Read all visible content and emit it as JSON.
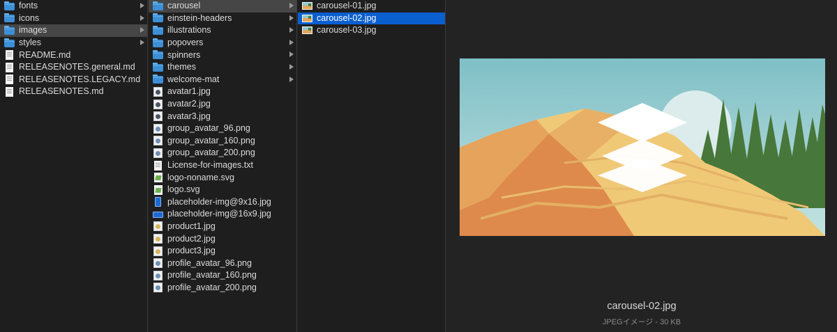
{
  "column1": {
    "items": [
      {
        "label": "fonts",
        "type": "folder"
      },
      {
        "label": "icons",
        "type": "folder"
      },
      {
        "label": "images",
        "type": "folder",
        "selected": true
      },
      {
        "label": "styles",
        "type": "folder"
      },
      {
        "label": "README.md",
        "type": "doc"
      },
      {
        "label": "RELEASENOTES.general.md",
        "type": "doc"
      },
      {
        "label": "RELEASENOTES.LEGACY.md",
        "type": "doc"
      },
      {
        "label": "RELEASENOTES.md",
        "type": "doc"
      }
    ]
  },
  "column2": {
    "items": [
      {
        "label": "carousel",
        "type": "folder",
        "selected": true
      },
      {
        "label": "einstein-headers",
        "type": "folder"
      },
      {
        "label": "illustrations",
        "type": "folder"
      },
      {
        "label": "popovers",
        "type": "folder"
      },
      {
        "label": "spinners",
        "type": "folder"
      },
      {
        "label": "themes",
        "type": "folder"
      },
      {
        "label": "welcome-mat",
        "type": "folder"
      },
      {
        "label": "avatar1.jpg",
        "type": "avatar"
      },
      {
        "label": "avatar2.jpg",
        "type": "avatar"
      },
      {
        "label": "avatar3.jpg",
        "type": "avatar"
      },
      {
        "label": "group_avatar_96.png",
        "type": "image"
      },
      {
        "label": "group_avatar_160.png",
        "type": "image"
      },
      {
        "label": "group_avatar_200.png",
        "type": "image"
      },
      {
        "label": "License-for-images.txt",
        "type": "doc"
      },
      {
        "label": "logo-noname.svg",
        "type": "svg"
      },
      {
        "label": "logo.svg",
        "type": "svg"
      },
      {
        "label": "placeholder-img@9x16.jpg",
        "type": "portrait"
      },
      {
        "label": "placeholder-img@16x9.jpg",
        "type": "landscape"
      },
      {
        "label": "product1.jpg",
        "type": "product"
      },
      {
        "label": "product2.jpg",
        "type": "product"
      },
      {
        "label": "product3.jpg",
        "type": "product"
      },
      {
        "label": "profile_avatar_96.png",
        "type": "image"
      },
      {
        "label": "profile_avatar_160.png",
        "type": "image"
      },
      {
        "label": "profile_avatar_200.png",
        "type": "image"
      }
    ]
  },
  "column3": {
    "items": [
      {
        "label": "carousel-01.jpg",
        "type": "thumb"
      },
      {
        "label": "carousel-02.jpg",
        "type": "thumb",
        "selected": true
      },
      {
        "label": "carousel-03.jpg",
        "type": "thumb"
      }
    ]
  },
  "preview": {
    "filename": "carousel-02.jpg",
    "info": "JPEGイメージ - 30 KB"
  },
  "colors": {
    "selection_active": "#0a5fd0",
    "selection_inactive": "#464647",
    "folder": "#3d8fd6"
  }
}
